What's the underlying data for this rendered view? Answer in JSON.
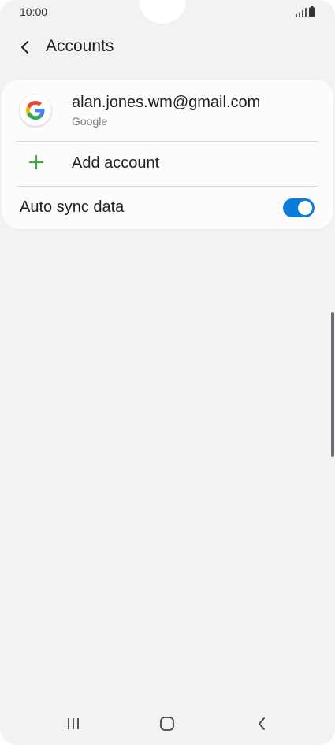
{
  "status_bar": {
    "time": "10:00",
    "signal_icon": "signal-icon",
    "battery_icon": "battery-icon"
  },
  "app_bar": {
    "back_icon": "back-arrow-icon",
    "title": "Accounts"
  },
  "accounts": [
    {
      "email": "alan.jones.wm@gmail.com",
      "type": "Google",
      "icon": "google-logo-icon"
    }
  ],
  "add_account": {
    "label": "Add account",
    "icon": "plus-icon",
    "color": "#3fa93f"
  },
  "auto_sync": {
    "label": "Auto sync data",
    "enabled": true,
    "accent_color": "#0b7cdb"
  },
  "nav_bar": {
    "recents_icon": "recents-icon",
    "home_icon": "home-icon",
    "back_icon": "back-icon"
  }
}
